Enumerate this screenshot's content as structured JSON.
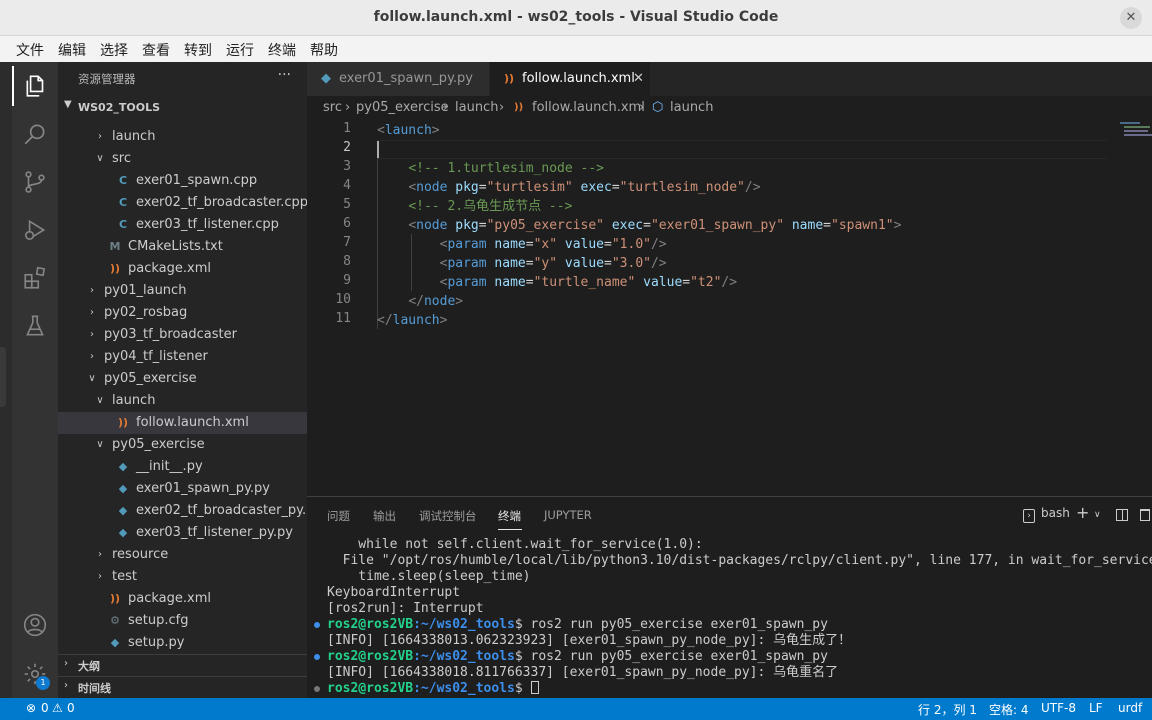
{
  "window": {
    "title": "follow.launch.xml - ws02_tools - Visual Studio Code",
    "close_glyph": "✕"
  },
  "menu": [
    "文件",
    "编辑",
    "选择",
    "查看",
    "转到",
    "运行",
    "终端",
    "帮助"
  ],
  "activity_bar": {
    "items": [
      "explorer-icon",
      "search-icon",
      "source-control-icon",
      "run-debug-icon",
      "extensions-icon",
      "testing-icon"
    ],
    "accounts": "account-icon",
    "settings": "settings-gear-icon",
    "settings_badge": "1"
  },
  "sidebar": {
    "title": "资源管理器",
    "more": "···",
    "workspace": "WS02_TOOLS",
    "tree": [
      {
        "label": "launch",
        "kind": "folder",
        "open": false,
        "depth": 2
      },
      {
        "label": "src",
        "kind": "folder",
        "open": true,
        "depth": 2
      },
      {
        "label": "exer01_spawn.cpp",
        "kind": "cpp",
        "depth": 3
      },
      {
        "label": "exer02_tf_broadcaster.cpp",
        "kind": "cpp",
        "depth": 3
      },
      {
        "label": "exer03_tf_listener.cpp",
        "kind": "cpp",
        "depth": 3
      },
      {
        "label": "CMakeLists.txt",
        "kind": "cmake",
        "depth": 2
      },
      {
        "label": "package.xml",
        "kind": "xml",
        "depth": 2
      },
      {
        "label": "py01_launch",
        "kind": "folder",
        "open": false,
        "depth": 1
      },
      {
        "label": "py02_rosbag",
        "kind": "folder",
        "open": false,
        "depth": 1
      },
      {
        "label": "py03_tf_broadcaster",
        "kind": "folder",
        "open": false,
        "depth": 1
      },
      {
        "label": "py04_tf_listener",
        "kind": "folder",
        "open": false,
        "depth": 1
      },
      {
        "label": "py05_exercise",
        "kind": "folder",
        "open": true,
        "depth": 1
      },
      {
        "label": "launch",
        "kind": "folder",
        "open": true,
        "depth": 2
      },
      {
        "label": "follow.launch.xml",
        "kind": "xml",
        "depth": 3,
        "selected": true
      },
      {
        "label": "py05_exercise",
        "kind": "folder",
        "open": true,
        "depth": 2
      },
      {
        "label": "__init__.py",
        "kind": "py",
        "depth": 3
      },
      {
        "label": "exer01_spawn_py.py",
        "kind": "py",
        "depth": 3
      },
      {
        "label": "exer02_tf_broadcaster_py.py",
        "kind": "py",
        "depth": 3
      },
      {
        "label": "exer03_tf_listener_py.py",
        "kind": "py",
        "depth": 3
      },
      {
        "label": "resource",
        "kind": "folder",
        "open": false,
        "depth": 2
      },
      {
        "label": "test",
        "kind": "folder",
        "open": false,
        "depth": 2
      },
      {
        "label": "package.xml",
        "kind": "xml",
        "depth": 2
      },
      {
        "label": "setup.cfg",
        "kind": "cfg",
        "depth": 2
      },
      {
        "label": "setup.py",
        "kind": "py",
        "depth": 2
      }
    ],
    "outline": "大纲",
    "timeline": "时间线"
  },
  "tabs": [
    {
      "label": "exer01_spawn_py.py",
      "active": false
    },
    {
      "label": "follow.launch.xml",
      "active": true,
      "close": "✕"
    }
  ],
  "breadcrumb": {
    "parts": [
      "src",
      "py05_exercise",
      "launch",
      "follow.launch.xml",
      "launch"
    ],
    "sep": "›"
  },
  "editor": {
    "current_line": 2,
    "lines": [
      "<launch>",
      "",
      "    <!-- 1.turtlesim_node -->",
      "    <node pkg=\"turtlesim\" exec=\"turtlesim_node\"/>",
      "    <!-- 2.乌龟生成节点 -->",
      "    <node pkg=\"py05_exercise\" exec=\"exer01_spawn_py\" name=\"spawn1\">",
      "        <param name=\"x\" value=\"1.0\"/>",
      "        <param name=\"y\" value=\"3.0\"/>",
      "        <param name=\"turtle_name\" value=\"t2\"/>",
      "    </node>",
      "</launch>"
    ]
  },
  "panel": {
    "tabs": [
      "问题",
      "输出",
      "调试控制台",
      "终端",
      "JUPYTER"
    ],
    "active_tab": "终端",
    "shell": "bash",
    "terminal": [
      {
        "text": "    while not self.client.wait_for_service(1.0):"
      },
      {
        "text": "  File \"/opt/ros/humble/local/lib/python3.10/dist-packages/rclpy/client.py\", line 177, in wait_for_service"
      },
      {
        "text": "    time.sleep(sleep_time)"
      },
      {
        "text": "KeyboardInterrupt"
      },
      {
        "text": "[ros2run]: Interrupt"
      },
      {
        "prompt_user": "ros2@ros2VB",
        "prompt_path": ":~/ws02_tools",
        "cmd": "$ ros2 run py05_exercise exer01_spawn_py",
        "dot": "#3b8eea"
      },
      {
        "text": "[INFO] [1664338013.062323923] [exer01_spawn_py_node_py]: 乌龟生成了！"
      },
      {
        "prompt_user": "ros2@ros2VB",
        "prompt_path": ":~/ws02_tools",
        "cmd": "$ ros2 run py05_exercise exer01_spawn_py",
        "dot": "#3b8eea"
      },
      {
        "text": "[INFO] [1664338018.811766337] [exer01_spawn_py_node_py]: 乌龟重名了"
      },
      {
        "prompt_user": "ros2@ros2VB",
        "prompt_path": ":~/ws02_tools",
        "cmd": "$ ",
        "dot": "#777777",
        "cursor": true
      }
    ]
  },
  "status": {
    "errors": "0",
    "warnings": "0",
    "position": "行 2，列 1",
    "indent": "空格: 4",
    "encoding": "UTF-8",
    "eol": "LF",
    "language": "urdf"
  }
}
